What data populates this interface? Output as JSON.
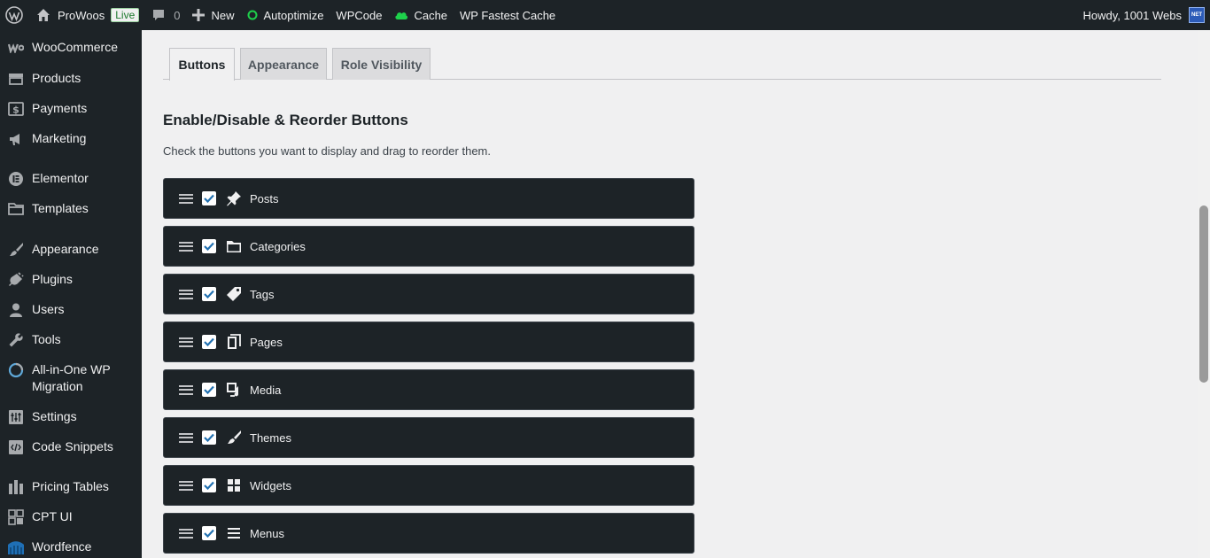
{
  "adminbar": {
    "site_name": "ProWoos",
    "live_badge": "Live",
    "comments_count": "0",
    "new_label": "New",
    "autoptimize_label": "Autoptimize",
    "wpcode_label": "WPCode",
    "cache_label": "Cache",
    "fastest_cache_label": "WP Fastest Cache",
    "howdy": "Howdy, 1001 Webs",
    "avatar_text": "NET"
  },
  "sidebar": {
    "items": [
      {
        "label": "WooCommerce",
        "icon": "woo-icon"
      },
      {
        "label": "Products",
        "icon": "products-icon"
      },
      {
        "label": "Payments",
        "icon": "payments-icon"
      },
      {
        "label": "Marketing",
        "icon": "marketing-icon"
      },
      {
        "label": "Elementor",
        "icon": "elementor-icon"
      },
      {
        "label": "Templates",
        "icon": "folder-icon"
      },
      {
        "label": "Appearance",
        "icon": "brush-icon"
      },
      {
        "label": "Plugins",
        "icon": "plug-icon"
      },
      {
        "label": "Users",
        "icon": "user-icon"
      },
      {
        "label": "Tools",
        "icon": "wrench-icon"
      },
      {
        "label": "All-in-One WP Migration",
        "icon": "migration-icon"
      },
      {
        "label": "Settings",
        "icon": "settings-icon"
      },
      {
        "label": "Code Snippets",
        "icon": "code-icon"
      },
      {
        "label": "Pricing Tables",
        "icon": "pricing-icon"
      },
      {
        "label": "CPT UI",
        "icon": "cpt-icon"
      },
      {
        "label": "Wordfence",
        "icon": "wordfence-icon"
      }
    ]
  },
  "tabs": [
    {
      "label": "Buttons",
      "active": true
    },
    {
      "label": "Appearance",
      "active": false
    },
    {
      "label": "Role Visibility",
      "active": false
    }
  ],
  "section": {
    "title": "Enable/Disable & Reorder Buttons",
    "description": "Check the buttons you want to display and drag to reorder them."
  },
  "buttons": [
    {
      "label": "Posts",
      "icon": "pin-icon",
      "checked": true
    },
    {
      "label": "Categories",
      "icon": "folder-icon",
      "checked": true
    },
    {
      "label": "Tags",
      "icon": "tag-icon",
      "checked": true
    },
    {
      "label": "Pages",
      "icon": "pages-icon",
      "checked": true
    },
    {
      "label": "Media",
      "icon": "media-icon",
      "checked": true
    },
    {
      "label": "Themes",
      "icon": "brush-icon",
      "checked": true
    },
    {
      "label": "Widgets",
      "icon": "widgets-icon",
      "checked": true
    },
    {
      "label": "Menus",
      "icon": "menu-icon",
      "checked": true
    }
  ],
  "colors": {
    "admin_dark": "#1d2327",
    "accent_blue": "#2271b1",
    "live_green": "#1d7a2e",
    "cache_green": "#1ed14b"
  }
}
